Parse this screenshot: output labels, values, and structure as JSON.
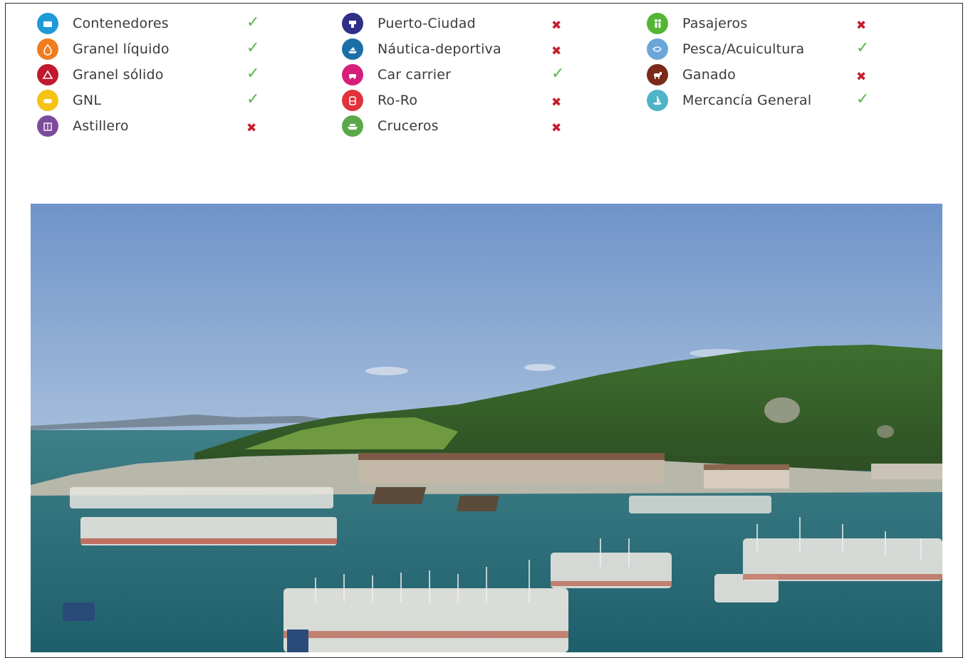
{
  "legend": {
    "columns": [
      {
        "items": [
          {
            "label": "Contenedores",
            "status": "yes",
            "mark": "✓",
            "icon": "container-icon",
            "color": "#1f9ad6"
          },
          {
            "label": "Granel líquido",
            "status": "yes",
            "mark": "✓",
            "icon": "liquid-bulk-icon",
            "color": "#f07c1e"
          },
          {
            "label": "Granel sólido",
            "status": "yes",
            "mark": "✓",
            "icon": "solid-bulk-icon",
            "color": "#c2192e"
          },
          {
            "label": "GNL",
            "status": "yes",
            "mark": "✓",
            "icon": "lng-icon",
            "color": "#f6c314"
          },
          {
            "label": "Astillero",
            "status": "no",
            "mark": "✖",
            "icon": "shipyard-icon",
            "color": "#7d4b9c"
          }
        ]
      },
      {
        "items": [
          {
            "label": "Puerto-Ciudad",
            "status": "no",
            "mark": "✖",
            "icon": "port-city-icon",
            "color": "#2e2f86"
          },
          {
            "label": "Náutica-deportiva",
            "status": "no",
            "mark": "✖",
            "icon": "nautical-sport-icon",
            "color": "#1b6fa8"
          },
          {
            "label": "Car carrier",
            "status": "yes",
            "mark": "✓",
            "icon": "car-carrier-icon",
            "color": "#d61f7a"
          },
          {
            "label": "Ro-Ro",
            "status": "no",
            "mark": "✖",
            "icon": "ro-ro-icon",
            "color": "#e1323d"
          },
          {
            "label": "Cruceros",
            "status": "no",
            "mark": "✖",
            "icon": "cruise-icon",
            "color": "#5aa84a"
          }
        ]
      },
      {
        "items": [
          {
            "label": "Pasajeros",
            "status": "no",
            "mark": "✖",
            "icon": "passengers-icon",
            "color": "#53b533"
          },
          {
            "label": "Pesca/Acuicultura",
            "status": "yes",
            "mark": "✓",
            "icon": "fishing-icon",
            "color": "#6aa6d8"
          },
          {
            "label": "Ganado",
            "status": "no",
            "mark": "✖",
            "icon": "livestock-icon",
            "color": "#7a2a1a"
          },
          {
            "label": "Mercancía General",
            "status": "yes",
            "mark": "✓",
            "icon": "general-cargo-icon",
            "color": "#4fb3c9"
          }
        ]
      }
    ]
  },
  "photo": {
    "subject": "aerial-port-photo"
  }
}
